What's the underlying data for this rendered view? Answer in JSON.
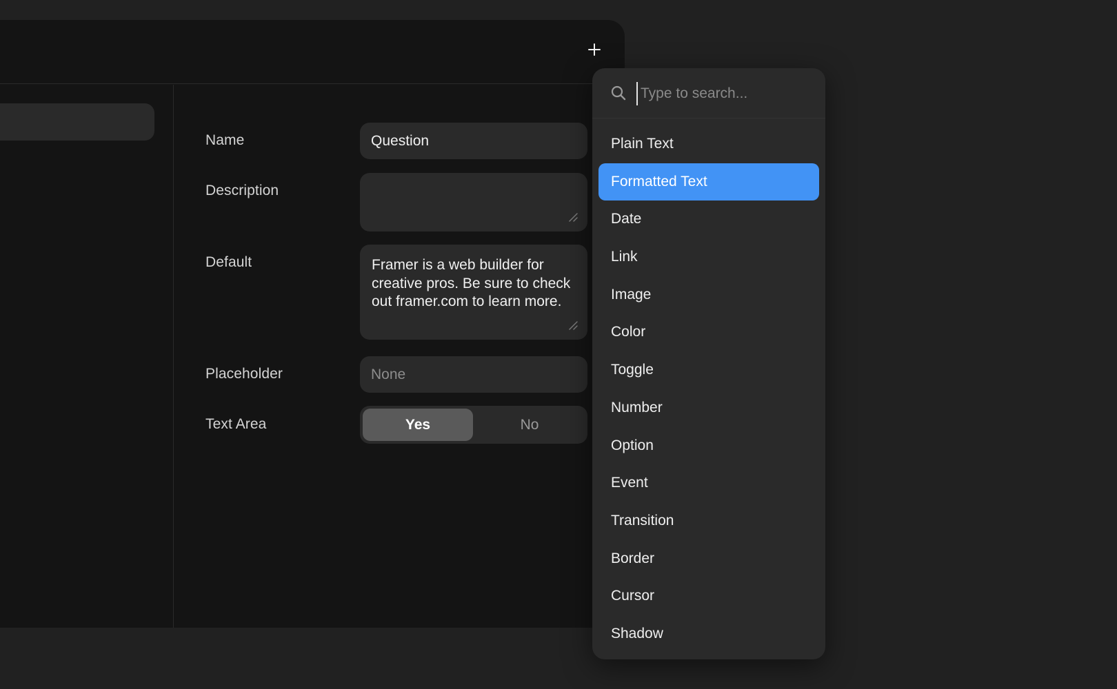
{
  "panel": {
    "add_icon": "plus-icon"
  },
  "form": {
    "name": {
      "label": "Name",
      "value": "Question"
    },
    "description": {
      "label": "Description",
      "value": ""
    },
    "default": {
      "label": "Default",
      "value": "Framer is a web builder for creative pros. Be sure to check out framer.com to learn more."
    },
    "placeholder": {
      "label": "Placeholder",
      "value": "None"
    },
    "text_area": {
      "label": "Text Area",
      "yes": "Yes",
      "no": "No",
      "selected": "Yes"
    }
  },
  "dropdown": {
    "search_placeholder": "Type to search...",
    "search_icon": "search-icon",
    "selected_color": "#4293f5",
    "items": [
      "Plain Text",
      "Formatted Text",
      "Date",
      "Link",
      "Image",
      "Color",
      "Toggle",
      "Number",
      "Option",
      "Event",
      "Transition",
      "Border",
      "Cursor",
      "Shadow"
    ],
    "selected_item": "Formatted Text"
  }
}
